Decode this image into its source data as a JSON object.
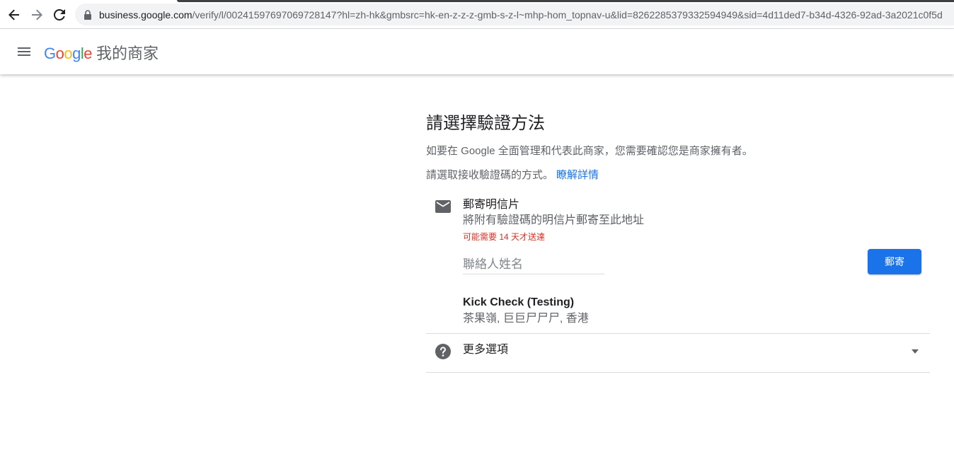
{
  "browser": {
    "url_host": "business.google.com",
    "url_path": "/verify/l/00241597697069728147?hl=zh-hk&gmbsrc=hk-en-z-z-z-gmb-s-z-l~mhp-hom_topnav-u&lid=8262285379332594949&sid=4d11ded7-b34d-4326-92ad-3a2021c0f5d"
  },
  "header": {
    "logo_letters": [
      "G",
      "o",
      "o",
      "g",
      "l",
      "e"
    ],
    "logo_colors": [
      "#4285F4",
      "#EA4335",
      "#FBBC05",
      "#4285F4",
      "#34A853",
      "#EA4335"
    ],
    "product_name": "我的商家"
  },
  "main": {
    "title": "請選擇驗證方法",
    "description": "如要在 Google 全面管理和代表此商家，您需要確認您是商家擁有者。",
    "choose_text": "請選取接收驗證碼的方式。",
    "learn_more": "瞭解詳情"
  },
  "postcard_option": {
    "icon": "mail-icon",
    "title": "郵寄明信片",
    "subtitle": "將附有驗證碼的明信片郵寄至此地址",
    "warning": "可能需要 14 天才送達",
    "contact_placeholder": "聯絡人姓名",
    "contact_value": "",
    "send_label": "郵寄",
    "business_name": "Kick Check (Testing)",
    "business_address": "茶果嶺, 巨巨尸尸尸, 香港"
  },
  "more_options": {
    "icon": "help-icon",
    "label": "更多選項"
  },
  "colors": {
    "accent": "#1a73e8",
    "warning": "#d93025"
  }
}
